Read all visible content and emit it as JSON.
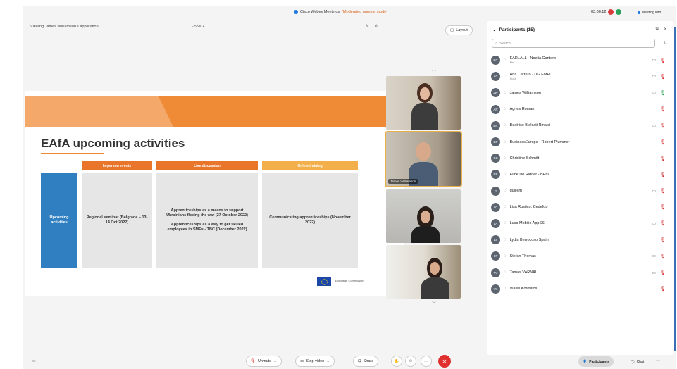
{
  "window": {
    "title": "Cisco Webex Meetings",
    "mode": "(Moderated unmute mode)",
    "timer": "03:00:12",
    "meeting_info": "Meeting info"
  },
  "share": {
    "viewing": "Viewing James Williamson's application",
    "zoom_label": "- 55% +",
    "layout_button": "Layout"
  },
  "slide": {
    "title": "EAfA upcoming activities",
    "row_label": "Upcoming activities",
    "columns": [
      {
        "header": "In-person events",
        "items": [
          "Regional seminar (Belgrade – 13-14 Oct 2022)"
        ]
      },
      {
        "header": "Live discussion",
        "items": [
          "Apprenticeships as a means to support Ukrainians fleeing the war (27 October 2022)",
          "Apprenticeships as a way to get skilled employees in SMEs - TBC (December 2022)"
        ]
      },
      {
        "header": "Online training",
        "items": [
          "Communicating apprenticeships (November 2022)"
        ]
      }
    ],
    "logo_text": "European Commission"
  },
  "videos": [
    {
      "name": ""
    },
    {
      "name": "James Williamson"
    },
    {
      "name": ""
    },
    {
      "name": ""
    }
  ],
  "participants_panel": {
    "title": "Participants (15)",
    "search_placeholder": "Search",
    "participants": [
      {
        "initials": "EC",
        "name": "EARLALL - Noelia Cantero",
        "role": "Me",
        "camera": true,
        "muted": true
      },
      {
        "initials": "AC",
        "name": "Ana Carrero - DG EMPL",
        "role": "Host",
        "camera": true,
        "muted": true
      },
      {
        "initials": "JW",
        "name": "James Williamson",
        "role": "",
        "camera": true,
        "muted": false
      },
      {
        "initials": "AR",
        "name": "Agnes Roman",
        "role": "",
        "camera": false,
        "muted": true
      },
      {
        "initials": "BR",
        "name": "Beatrice Biolcati Rinaldi",
        "role": "",
        "camera": true,
        "muted": true
      },
      {
        "initials": "BP",
        "name": "BusinessEurope - Robert Plummer",
        "role": "",
        "camera": false,
        "muted": true
      },
      {
        "initials": "CS",
        "name": "Christine Schmitt",
        "role": "",
        "camera": false,
        "muted": true
      },
      {
        "initials": "EB",
        "name": "Eline De Ridder - BEnI",
        "role": "",
        "camera": false,
        "muted": true
      },
      {
        "initials": "G",
        "name": "guillem",
        "role": "",
        "camera": true,
        "muted": true
      },
      {
        "initials": "LC",
        "name": "Lisa Rustico, Cedefop",
        "role": "",
        "camera": false,
        "muted": true
      },
      {
        "initials": "LA",
        "name": "Luca Mobilio AppSS",
        "role": "",
        "camera": true,
        "muted": true
      },
      {
        "initials": "LS",
        "name": "Lydia Berrocoso Spain",
        "role": "",
        "camera": false,
        "muted": true
      },
      {
        "initials": "ST",
        "name": "Stefan Thomas",
        "role": "",
        "camera": true,
        "muted": true
      },
      {
        "initials": "TV",
        "name": "Tamas VARNAI",
        "role": "",
        "camera": true,
        "muted": true
      },
      {
        "initials": "VK",
        "name": "Vlasis Korovilos",
        "role": "",
        "camera": false,
        "muted": true
      }
    ]
  },
  "controls": {
    "unmute": "Unmute",
    "stop_video": "Stop video",
    "share": "Share",
    "participants": "Participants",
    "chat": "Chat"
  },
  "colors": {
    "accent_orange": "#ef8a36",
    "label_blue": "#2f7fc1",
    "end_red": "#e0302e",
    "mute_red": "#d93a3a"
  },
  "icons": [
    "caption-icon",
    "mic-muted-icon",
    "video-icon",
    "share-icon",
    "reactions-icon",
    "end-call-icon",
    "participants-icon",
    "chat-icon",
    "more-icon",
    "search-icon"
  ]
}
